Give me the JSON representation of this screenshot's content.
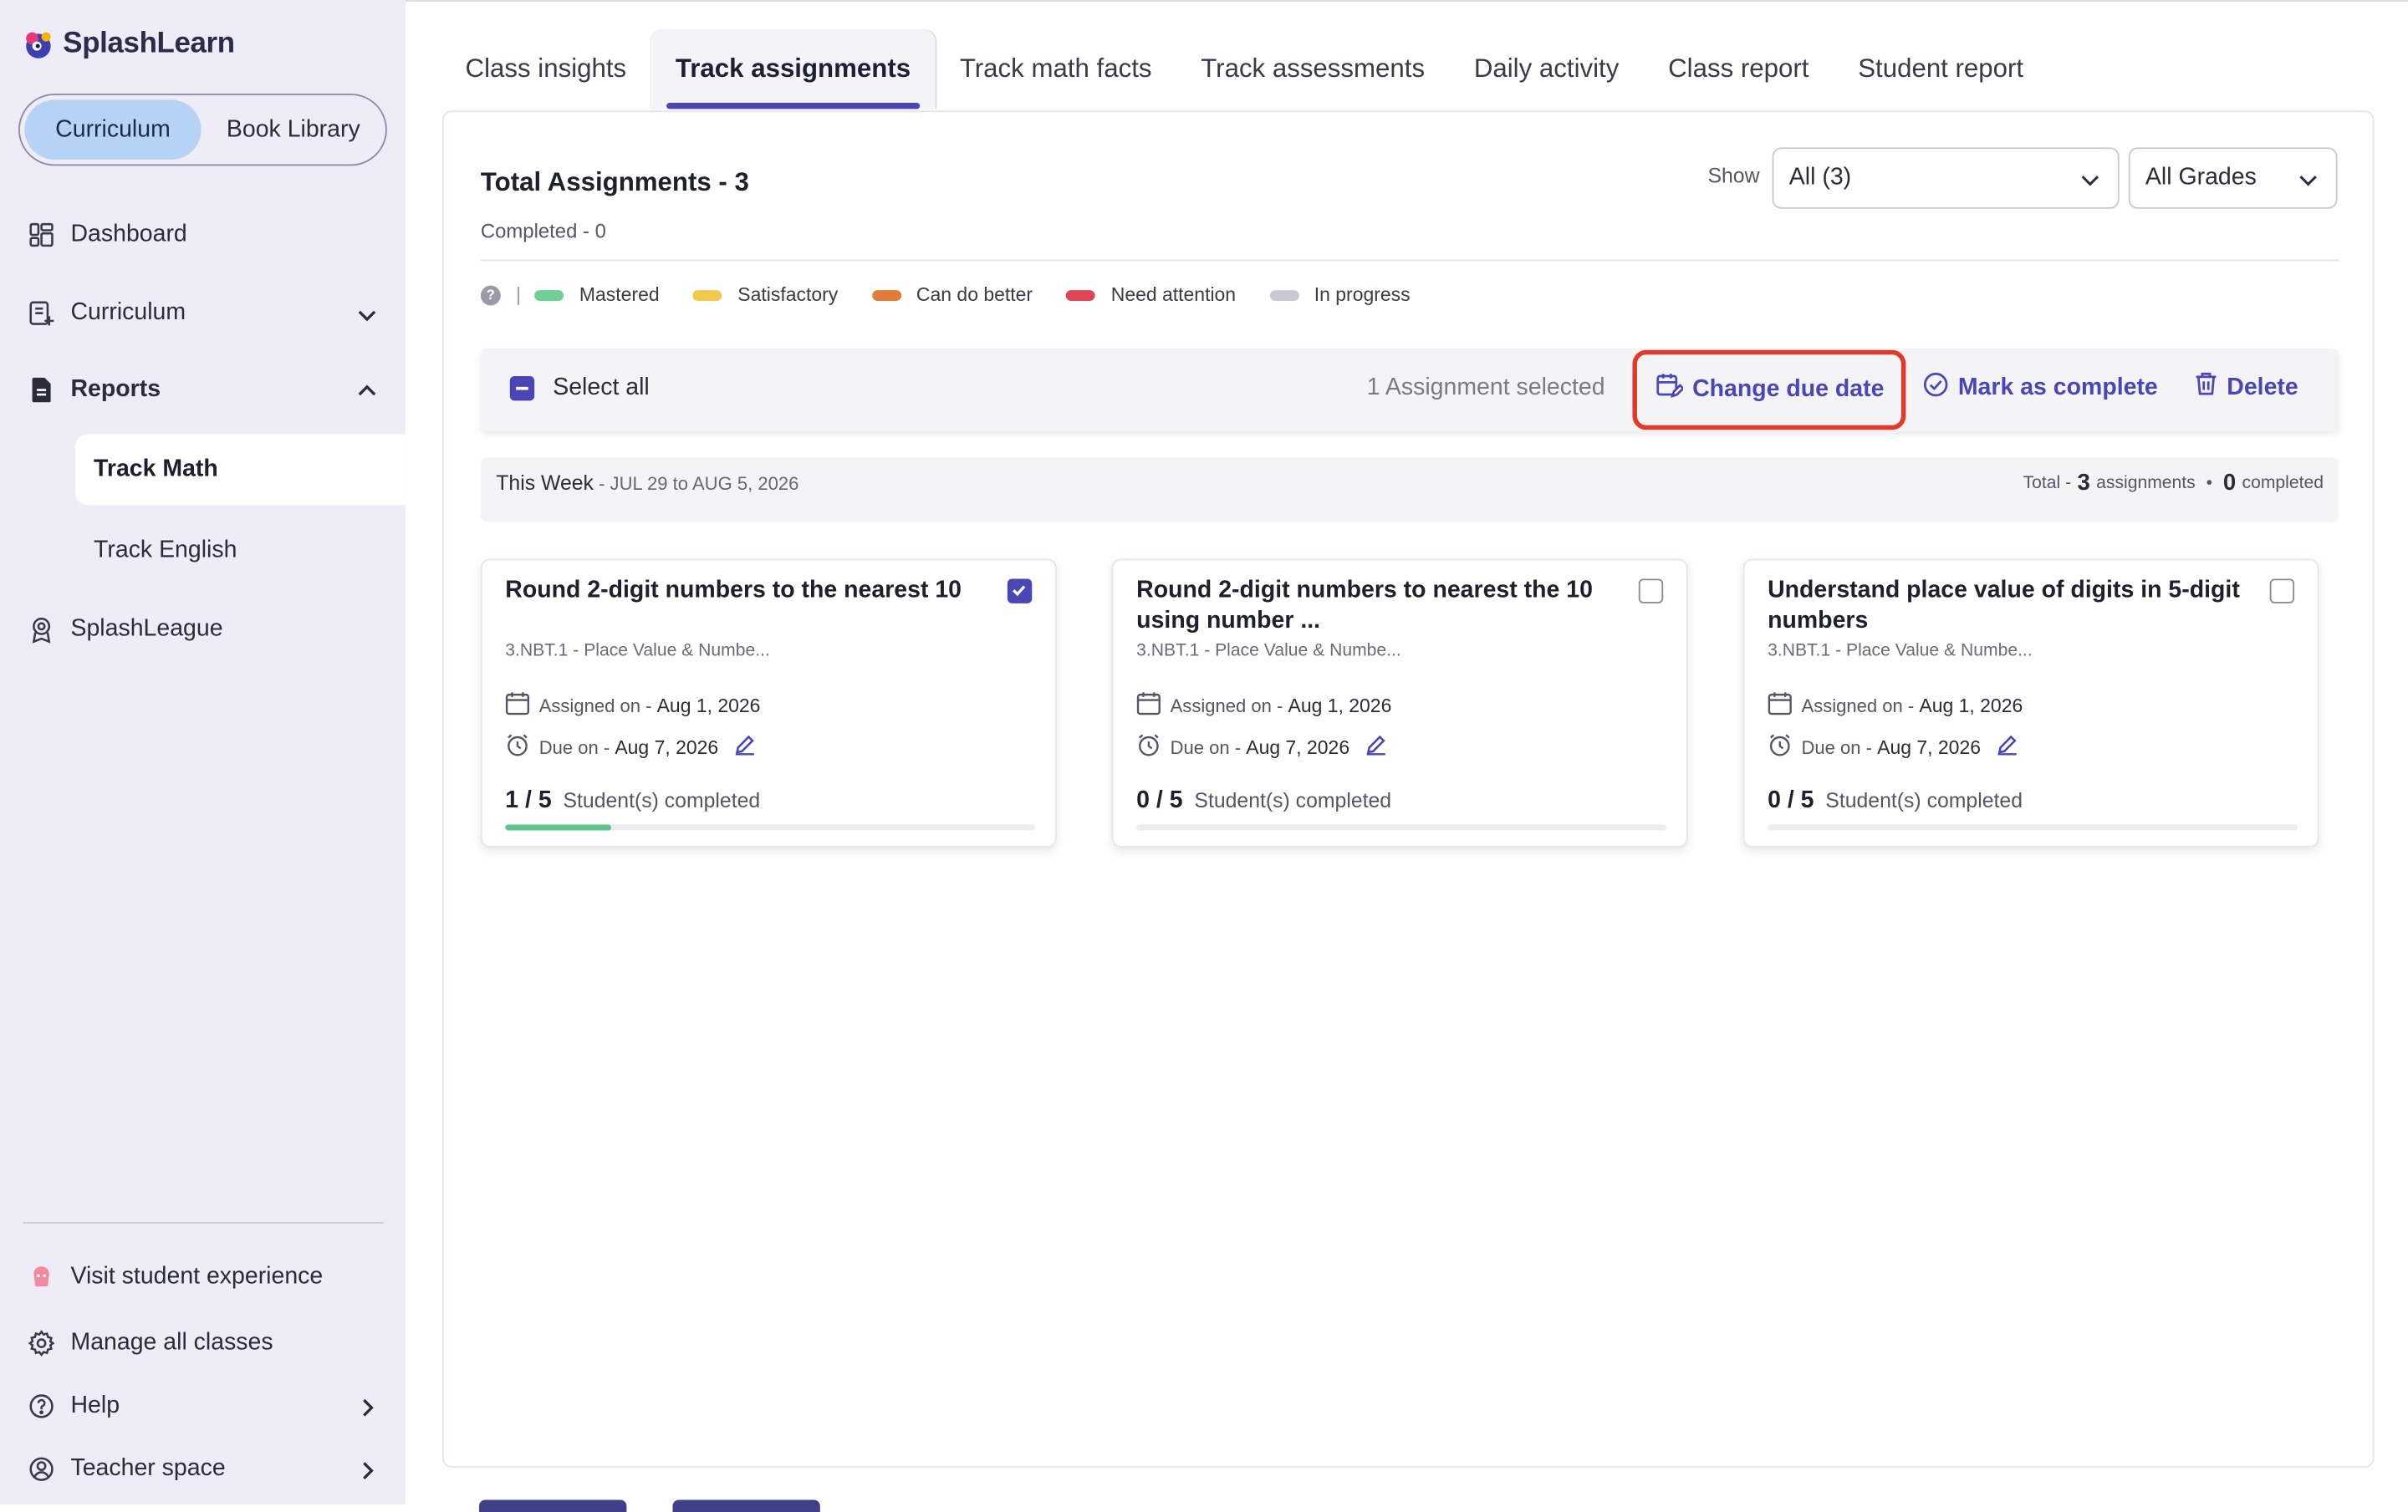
{
  "app": {
    "brand": "SplashLearn",
    "colors": {
      "accent": "#4b46b6",
      "sidebar_bg": "#eeedf7",
      "segment_active": "#b6d3f5",
      "highlight": "#e23a2a"
    }
  },
  "sidebar": {
    "segments": [
      {
        "label": "Curriculum",
        "active": true
      },
      {
        "label": "Book Library",
        "active": false
      }
    ],
    "nav": {
      "dashboard": {
        "label": "Dashboard",
        "icon": "dashboard-icon"
      },
      "curriculum": {
        "label": "Curriculum",
        "icon": "curriculum-icon"
      },
      "reports": {
        "label": "Reports",
        "icon": "reports-icon",
        "expanded": true
      },
      "track_math": {
        "label": "Track Math",
        "active": true
      },
      "track_english": {
        "label": "Track English"
      },
      "splashleague": {
        "label": "SplashLeague",
        "icon": "trophy-icon"
      }
    },
    "footer": {
      "visit": "Visit student experience",
      "manage": "Manage all classes",
      "help": "Help",
      "teacher": "Teacher space"
    }
  },
  "tabs": [
    {
      "label": "Class insights",
      "active": false
    },
    {
      "label": "Track assignments",
      "active": true
    },
    {
      "label": "Track math facts",
      "active": false
    },
    {
      "label": "Track assessments",
      "active": false
    },
    {
      "label": "Daily activity",
      "active": false
    },
    {
      "label": "Class report",
      "active": false
    },
    {
      "label": "Student report",
      "active": false
    }
  ],
  "summary": {
    "title": "Total Assignments - 3",
    "completed": "Completed - 0"
  },
  "filters": {
    "show_label": "Show",
    "show_value": "All (3)",
    "grade_value": "All Grades"
  },
  "legend": [
    {
      "label": "Mastered",
      "color": "#6fcf97"
    },
    {
      "label": "Satisfactory",
      "color": "#f2c94c"
    },
    {
      "label": "Can do better",
      "color": "#e07b39"
    },
    {
      "label": "Need attention",
      "color": "#e04555"
    },
    {
      "label": "In progress",
      "color": "#c9c9d6"
    }
  ],
  "actionbar": {
    "select_all": "Select all",
    "selected_count": "1 Assignment selected",
    "change_due": "Change due date",
    "mark_complete": "Mark as complete",
    "delete": "Delete"
  },
  "week": {
    "title": "This Week",
    "range": " - JUL 29 to AUG 5, 2026",
    "total_prefix": "Total - ",
    "total_count": "3",
    "assignments_word": "assignments",
    "completed_count": "0",
    "completed_word": "completed"
  },
  "cards": [
    {
      "title": "Round 2-digit numbers to the nearest 10",
      "standard": "3.NBT.1 - Place Value & Numbe...",
      "assigned_label": "Assigned on - ",
      "assigned_date": "Aug 1, 2026",
      "due_label": "Due on - ",
      "due_date": "Aug 7, 2026",
      "done": "1 / 5",
      "done_label": "Student(s) completed",
      "progress": 0.2,
      "checked": true
    },
    {
      "title": "Round 2-digit numbers to nearest the 10 using number ...",
      "standard": "3.NBT.1 - Place Value & Numbe...",
      "assigned_label": "Assigned on - ",
      "assigned_date": "Aug 1, 2026",
      "due_label": "Due on - ",
      "due_date": "Aug 7, 2026",
      "done": "0 / 5",
      "done_label": "Student(s) completed",
      "progress": 0,
      "checked": false
    },
    {
      "title": "Understand place value of digits in 5-digit numbers",
      "standard": "3.NBT.1 - Place Value & Numbe...",
      "assigned_label": "Assigned on - ",
      "assigned_date": "Aug 1, 2026",
      "due_label": "Due on - ",
      "due_date": "Aug 7, 2026",
      "done": "0 / 5",
      "done_label": "Student(s) completed",
      "progress": 0,
      "checked": false
    }
  ]
}
